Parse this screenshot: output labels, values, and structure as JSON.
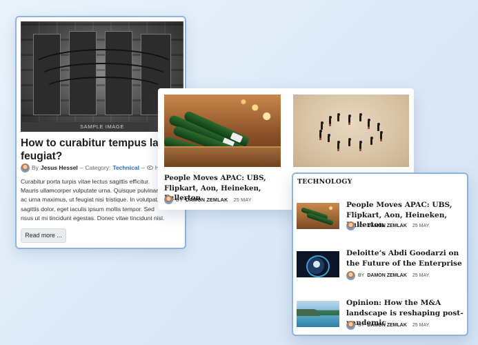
{
  "article_card": {
    "image_caption": "SAMPLE IMAGE",
    "title_line1": "How to curabitur tempus lacus id",
    "title_line2": "feugiat?",
    "meta": {
      "by": "By",
      "author": "Jesus Hessel",
      "separator": "–",
      "category_label": "Category:",
      "category": "Technical",
      "hits_label": "Hits:"
    },
    "excerpt_lines": [
      "Curabitur porta turpis vitae lectus sagittis efficitur.",
      "Mauris ullamcorper vulputate urna. Quisque pulvinar",
      "ac urna maximus, ut feugiat nisi tristique. In volutpat,",
      "sagittis dolor, eget iaculis ipsum mollis tempor. Sed",
      "risus ut mi tincidunt egestas. Donec vitae tincidunt nisl."
    ],
    "read_more": "Read more ..."
  },
  "featured_card": {
    "title": "People Moves APAC: UBS, Flipkart, Aon, Heineken, Fullerton",
    "by": "BY",
    "author": "DAMON ZEMLAK",
    "date": "25 MAY"
  },
  "tech_card": {
    "heading": "TECHNOLOGY",
    "items": [
      {
        "title": "People Moves APAC: UBS, Flipkart, Aon, Heineken, Fullerton",
        "by": "BY",
        "author": "DAMON ZEMLAK",
        "date": "25 MAY"
      },
      {
        "title": "Deloitte’s Abdi Goodarzi on the Future of the Enterprise",
        "by": "BY",
        "author": "DAMON ZEMLAK",
        "date": "25 MAY"
      },
      {
        "title": "Opinion: How the M&A landscape is reshaping post-pandemic",
        "by": "BY",
        "author": "DAMON ZEMLAK",
        "date": "25 MAY"
      }
    ]
  },
  "colors": {
    "background": "#dce9f7",
    "card_border": "#8fb3df",
    "category_link": "#2b6bc0"
  }
}
